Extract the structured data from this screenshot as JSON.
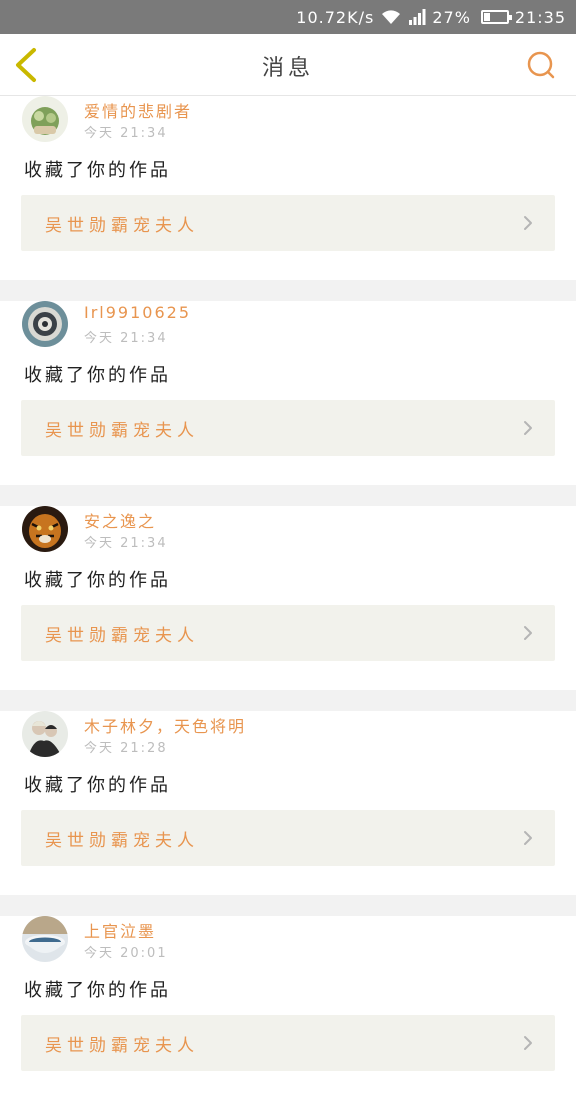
{
  "status_bar": {
    "speed": "10.72K/s",
    "battery": "27%",
    "battery_level": 0.27,
    "time": "21:35",
    "wifi_icon": "wifi-icon",
    "signal_icon": "signal-icon"
  },
  "header": {
    "title": "消息",
    "back_icon": "chevron-left-icon",
    "search_icon": "search-icon",
    "accent": "#e8954f",
    "back_color": "#c9b800"
  },
  "messages": [
    {
      "user": "爱情的悲剧者",
      "time": "今天 21:34",
      "action": "收藏了你的作品",
      "work_title": "吴世勋霸宠夫人",
      "avatar": "avatar-plant"
    },
    {
      "user": "Irl9910625",
      "time": "今天 21:34",
      "action": "收藏了你的作品",
      "work_title": "吴世勋霸宠夫人",
      "avatar": "avatar-swirl"
    },
    {
      "user": "安之逸之",
      "time": "今天 21:34",
      "action": "收藏了你的作品",
      "work_title": "吴世勋霸宠夫人",
      "avatar": "avatar-tiger"
    },
    {
      "user": "木子林夕，天色将明",
      "time": "今天 21:28",
      "action": "收藏了你的作品",
      "work_title": "吴世勋霸宠夫人",
      "avatar": "avatar-couple"
    },
    {
      "user": "上官泣墨",
      "time": "今天 20:01",
      "action": "收藏了你的作品",
      "work_title": "吴世勋霸宠夫人",
      "avatar": "avatar-bowl"
    }
  ]
}
